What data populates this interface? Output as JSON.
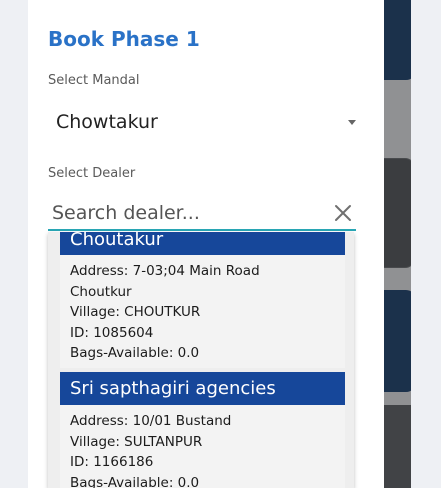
{
  "dialog": {
    "title": "Book Phase 1",
    "mandal_label": "Select Mandal",
    "mandal_value": "Chowtakur",
    "dealer_label": "Select Dealer",
    "search_placeholder": "Search dealer..."
  },
  "dealers": [
    {
      "name": "Choutakur",
      "address": "Address: 7-03;04 Main Road",
      "address2": "Choutkur",
      "village": "Village: CHOUTKUR",
      "id": "ID: 1085604",
      "bags": "Bags-Available: 0.0"
    },
    {
      "name": "Sri sapthagiri agencies",
      "address": "Address: 10/01 Bustand",
      "village": "Village: SULTANPUR",
      "id": "ID: 1166186",
      "bags": "Bags-Available: 0.0"
    }
  ],
  "colors": {
    "title": "#2a72c7",
    "dealer_header": "#16479a",
    "underline": "#29a6b5"
  },
  "icons": {
    "clear": "close-icon",
    "dropdown": "caret-down-icon"
  }
}
